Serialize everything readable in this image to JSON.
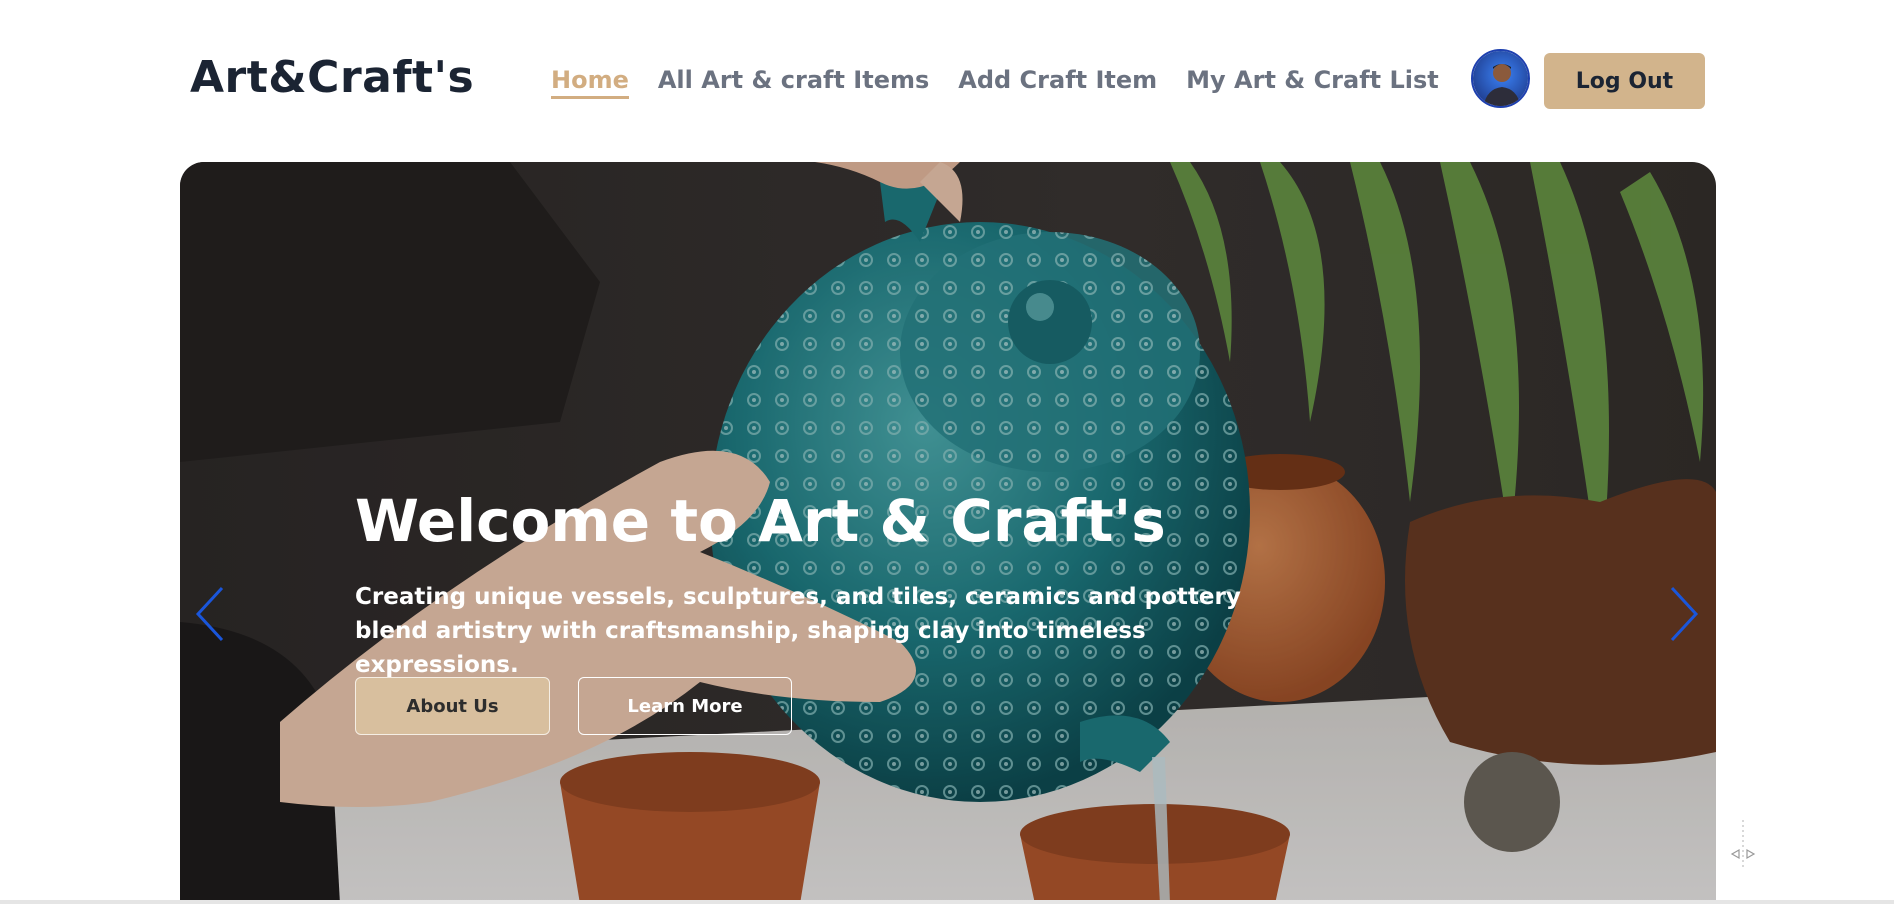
{
  "brand": {
    "logo_text": "Art&Craft's"
  },
  "nav": {
    "items": [
      {
        "label": "Home",
        "active": true
      },
      {
        "label": "All Art & craft Items",
        "active": false
      },
      {
        "label": "Add Craft Item",
        "active": false
      },
      {
        "label": "My Art & Craft List",
        "active": false
      }
    ]
  },
  "user": {
    "avatar_icon": "user-avatar",
    "logout_label": "Log Out"
  },
  "hero": {
    "title": "Welcome to Art & Craft's",
    "subtitle": "Creating unique vessels, sculptures, and tiles, ceramics and pottery blend artistry with craftsmanship, shaping clay into timeless expressions.",
    "about_label": "About Us",
    "learn_label": "Learn More",
    "prev_icon": "chevron-left-icon",
    "next_icon": "chevron-right-icon"
  },
  "colors": {
    "accent": "#d2ad81",
    "button_bg": "#d2b48c",
    "text_dark": "#1b2433",
    "nav_gray": "#6b7280",
    "arrow_blue": "#1a56db"
  }
}
